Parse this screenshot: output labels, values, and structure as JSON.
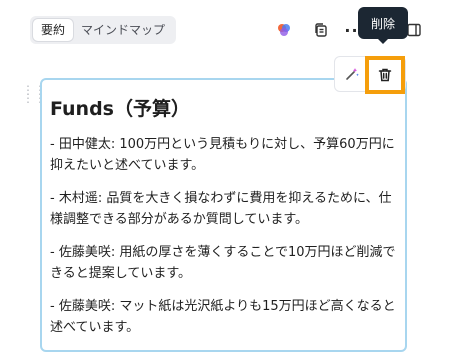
{
  "tabs": [
    {
      "label": "要約",
      "active": true
    },
    {
      "label": "マインドマップ",
      "active": false
    }
  ],
  "toolbar": {
    "icons": [
      "ai-sparkle-icon",
      "copy-icon",
      "more-icon",
      "panel-icon"
    ],
    "more_label": "···"
  },
  "tooltip": {
    "text": "削除"
  },
  "card_toolbar": {
    "icons": [
      "magic-wand-icon",
      "trash-icon"
    ],
    "highlight_color": "#f59e0b"
  },
  "card": {
    "title": "Funds（予算）",
    "paragraphs": [
      "- 田中健太: 100万円という見積もりに対し、予算60万円に抑えたいと述べています。",
      "- 木村遥: 品質を大きく損なわずに費用を抑えるために、仕様調整できる部分があるか質問しています。",
      "- 佐藤美咲: 用紙の厚さを薄くすることで10万円ほど削減できると提案しています。",
      "- 佐藤美咲: マット紙は光沢紙よりも15万円ほど高くなると述べています。"
    ],
    "border_color": "#a8d6ef"
  }
}
